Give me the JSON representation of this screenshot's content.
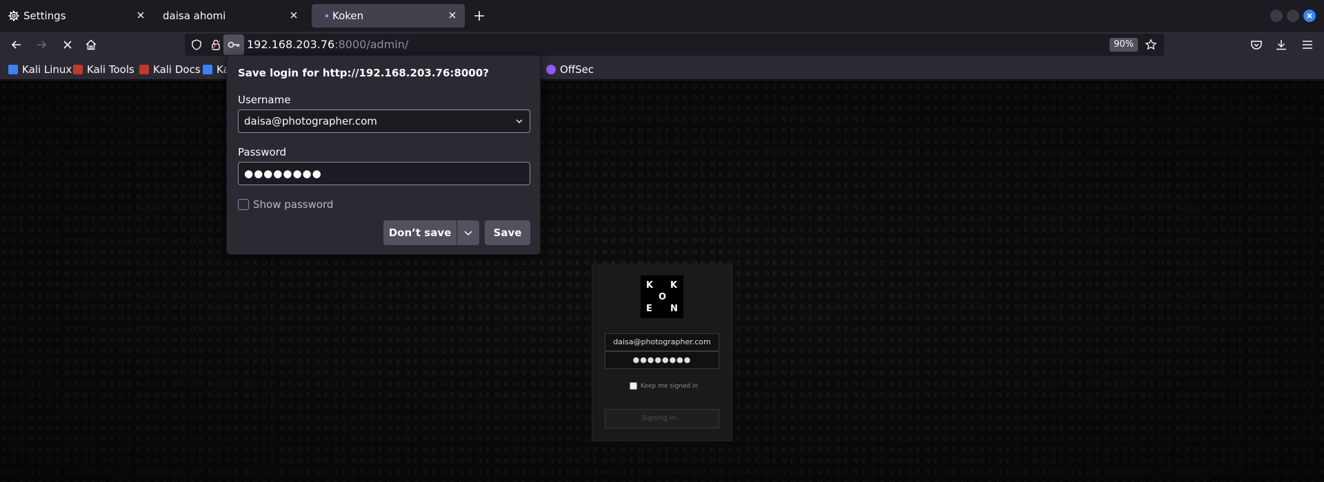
{
  "tabs": [
    {
      "title": "Settings",
      "icon": "gear-icon"
    },
    {
      "title": "daisa ahomi"
    },
    {
      "title": "Koken",
      "active": true
    }
  ],
  "navbar": {
    "url_host": "192.168.203.76",
    "url_rest": ":8000/admin/",
    "zoom": "90%"
  },
  "bookmarks": [
    {
      "label": "Kali Linux",
      "color": "#3b82f6"
    },
    {
      "label": "Kali Tools",
      "color": "#c0392b"
    },
    {
      "label": "Kali Docs",
      "color": "#c0392b"
    },
    {
      "label": "Ka",
      "color": "#3b82f6"
    },
    {
      "label": "OffSec",
      "color": "#8b5cf6"
    }
  ],
  "popup": {
    "title": "Save login for http://192.168.203.76:8000?",
    "username_label": "Username",
    "username_value": "daisa@photographer.com",
    "password_label": "Password",
    "password_value": "●●●●●●●●",
    "show_password_label": "Show password",
    "dont_save_label": "Don’t save",
    "save_label": "Save"
  },
  "login": {
    "logo_letters": [
      "K",
      "K",
      "O",
      "E",
      "N"
    ],
    "email": "daisa@photographer.com",
    "password": "●●●●●●●●",
    "keep_signed_in": "Keep me signed in",
    "signing_in": "Signing in..."
  },
  "colors": {
    "accent": "#3b82f6",
    "toolbar": "#2b2a33",
    "page_bg": "#0d0d0d"
  }
}
